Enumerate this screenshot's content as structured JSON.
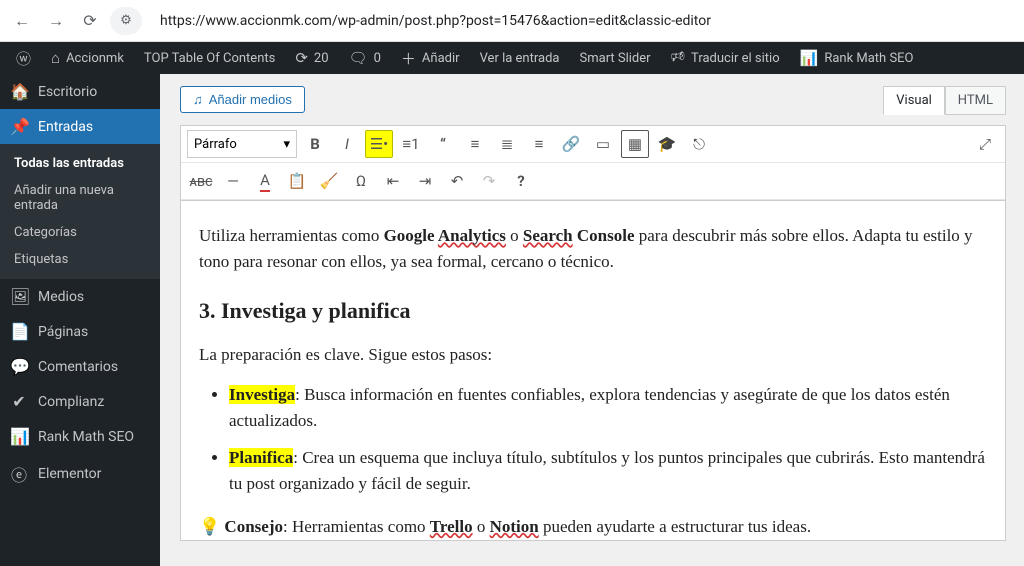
{
  "browser": {
    "url": "https://www.accionmk.com/wp-admin/post.php?post=15476&action=edit&classic-editor"
  },
  "adminbar": {
    "site": "Accionmk",
    "toc": "TOP Table Of Contents",
    "updates": "20",
    "comments": "0",
    "add": "Añadir",
    "view": "Ver la entrada",
    "smartslider": "Smart Slider",
    "translate": "Traducir el sitio",
    "rankmath": "Rank Math SEO"
  },
  "sidebar": {
    "dashboard": "Escritorio",
    "posts": "Entradas",
    "posts_sub": {
      "all": "Todas las entradas",
      "new": "Añadir una nueva entrada",
      "categories": "Categorías",
      "tags": "Etiquetas"
    },
    "media": "Medios",
    "pages": "Páginas",
    "comments": "Comentarios",
    "complianz": "Complianz",
    "rankmath": "Rank Math SEO",
    "elementor": "Elementor"
  },
  "editor": {
    "add_media": "Añadir medios",
    "tab_visual": "Visual",
    "tab_html": "HTML",
    "format": "Párrafo"
  },
  "content": {
    "p1_a": "Utiliza herramientas como ",
    "p1_b": "Google ",
    "p1_c": "Analytics",
    "p1_d": " o ",
    "p1_e": "Search",
    "p1_f": " Console",
    "p1_g": " para descubrir más sobre ellos. Adapta tu estilo y tono para resonar con ellos, ya sea formal, cercano o técnico.",
    "h3": "3. Investiga y planifica",
    "p2": "La preparación es clave. Sigue estos pasos:",
    "li1_a": "Investiga",
    "li1_b": ": Busca información en fuentes confiables, explora tendencias y asegúrate de que los datos estén actualizados.",
    "li2_a": "Planifica",
    "li2_b": ": Crea un esquema que incluya título, subtítulos y los puntos principales que cubrirás. Esto mantendrá tu post organizado y fácil de seguir.",
    "tip_a": "Consejo",
    "tip_b": ": Herramientas como ",
    "tip_c": "Trello",
    "tip_d": " o ",
    "tip_e": "Notion",
    "tip_f": " pueden ayudarte a estructurar tus ideas."
  }
}
